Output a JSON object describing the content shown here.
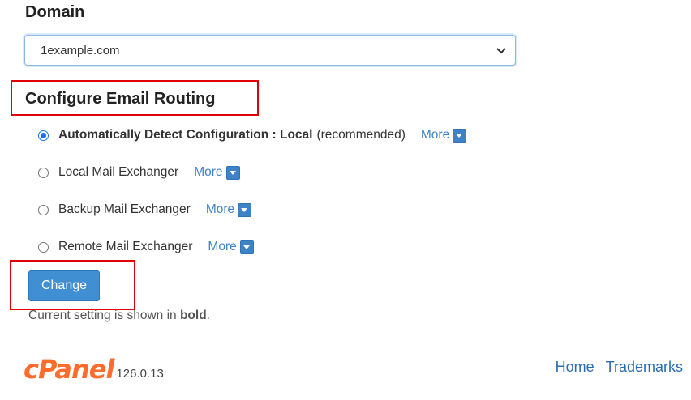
{
  "domain": {
    "label": "Domain",
    "selected": "1example.com"
  },
  "routing": {
    "heading": "Configure Email Routing",
    "options": [
      {
        "label": "Automatically Detect Configuration : Local",
        "suffix": "(recommended)",
        "more": "More",
        "checked": true
      },
      {
        "label": "Local Mail Exchanger",
        "more": "More",
        "checked": false
      },
      {
        "label": "Backup Mail Exchanger",
        "more": "More",
        "checked": false
      },
      {
        "label": "Remote Mail Exchanger",
        "more": "More",
        "checked": false
      }
    ]
  },
  "actions": {
    "change_label": "Change"
  },
  "note": {
    "prefix": "Current setting is shown in",
    "bold": "bold",
    "suffix": "."
  },
  "footer": {
    "logo": "cPanel",
    "version": "126.0.13",
    "links": [
      "Home",
      "Trademarks"
    ]
  },
  "colors": {
    "accent": "#3f8fd2",
    "link": "#3f83c6",
    "highlight_box": "#e00000",
    "logo": "#ff6c2c"
  }
}
